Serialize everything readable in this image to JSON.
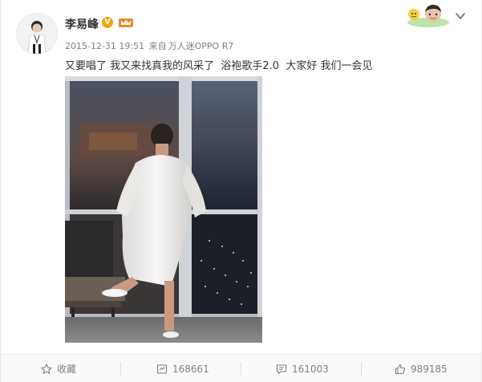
{
  "post": {
    "username": "李易峰",
    "verified_badge": "V",
    "timestamp": "2015-12-31 19:51",
    "source_prefix": "来自",
    "source": "万人迷OPPO R7",
    "text": "又要唱了 我又来找真我的风采了  浴袍歌手2.0  大家好 我们一会见"
  },
  "actions": {
    "favorite_label": "收藏",
    "repost_count": "168661",
    "comment_count": "161003",
    "like_count": "989185"
  },
  "icons": {
    "favorite": "star-icon",
    "repost": "repost-icon",
    "comment": "comment-icon",
    "like": "thumbs-up-icon",
    "menu": "chevron-down-icon"
  },
  "colors": {
    "text_primary": "#333333",
    "text_secondary": "#808080",
    "verified_badge": "#f4a20b"
  }
}
